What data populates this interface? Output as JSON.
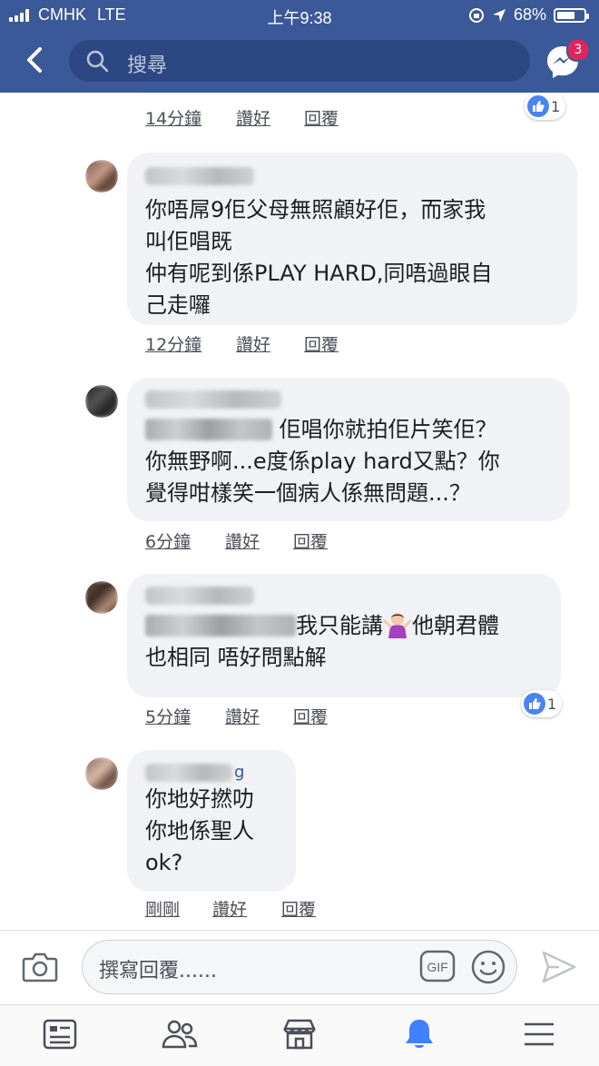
{
  "status": {
    "carrier": "CMHK",
    "network": "LTE",
    "time": "上午9:38",
    "battery": "68%",
    "battery_level": 0.68
  },
  "header": {
    "search_placeholder": "搜尋",
    "messenger_badge": "3"
  },
  "comments": [
    {
      "text": "",
      "time": "14分鐘",
      "like": "讚好",
      "reply": "回覆",
      "reactions": "1"
    },
    {
      "text": "你唔屌9佢父母無照顧好佢，而家我\n叫佢唱既\n仲有呢到係PLAY HARD,同唔過眼自\n己走囉",
      "time": "12分鐘",
      "like": "讚好",
      "reply": "回覆"
    },
    {
      "text_line1": "佢唱你就拍佢片笑佢？",
      "text_rest": "你無野啊...e度係play hard又點？你\n覺得咁樣笑一個病人係無問題...？",
      "time": "6分鐘",
      "like": "讚好",
      "reply": "回覆"
    },
    {
      "text_line1a": "我只能講",
      "text_line1b": "他朝君體",
      "text_rest": "也相同 唔好問點解",
      "time": "5分鐘",
      "like": "讚好",
      "reply": "回覆",
      "reactions": "1"
    },
    {
      "name_tail": "g",
      "text": "你地好撚叻\n你地係聖人\nok?",
      "time": "剛剛",
      "like": "讚好",
      "reply": "回覆"
    }
  ],
  "composer": {
    "placeholder": "撰寫回覆......",
    "gif_label": "GIF"
  },
  "tabs": [
    "news-feed",
    "friends",
    "marketplace",
    "notifications",
    "menu"
  ],
  "colors": {
    "brand": "#3b5998",
    "active_tab": "#4080ff",
    "bubble": "#f1f2f6"
  }
}
